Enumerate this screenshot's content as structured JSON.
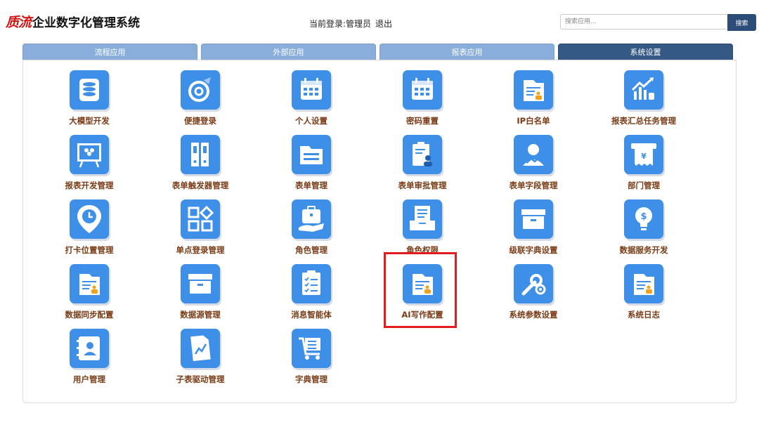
{
  "header": {
    "logo_mark": "质流",
    "title": "企业数字化管理系统",
    "login_label": "当前登录:管理员",
    "logout": "退出",
    "search_placeholder": "搜索应用...",
    "search_button": "搜索"
  },
  "tabs": [
    {
      "label": "流程应用",
      "active": false
    },
    {
      "label": "外部应用",
      "active": false
    },
    {
      "label": "报表应用",
      "active": false
    },
    {
      "label": "系统设置",
      "active": true
    }
  ],
  "apps": [
    {
      "label": "大模型开发",
      "icon": "database-icon"
    },
    {
      "label": "便捷登录",
      "icon": "quick-login-icon"
    },
    {
      "label": "个人设置",
      "icon": "calendar-icon"
    },
    {
      "label": "密码重置",
      "icon": "calendar-icon"
    },
    {
      "label": "IP白名单",
      "icon": "document-users-icon"
    },
    {
      "label": "报表汇总任务管理",
      "icon": "chart-growth-icon"
    },
    {
      "label": "报表开发管理",
      "icon": "presentation-board-icon"
    },
    {
      "label": "表单触发器管理",
      "icon": "binders-icon"
    },
    {
      "label": "表单管理",
      "icon": "folder-icon"
    },
    {
      "label": "表单审批管理",
      "icon": "clipboard-user-icon"
    },
    {
      "label": "表单字段管理",
      "icon": "user-chart-icon"
    },
    {
      "label": "部门管理",
      "icon": "receipt-icon"
    },
    {
      "label": "打卡位置管理",
      "icon": "location-clock-icon"
    },
    {
      "label": "单点登录管理",
      "icon": "grid-apps-icon"
    },
    {
      "label": "角色管理",
      "icon": "briefcase-hand-icon"
    },
    {
      "label": "角色权限",
      "icon": "document-tray-icon"
    },
    {
      "label": "级联字典设置",
      "icon": "archive-box-icon"
    },
    {
      "label": "数据服务开发",
      "icon": "lightbulb-dollar-icon"
    },
    {
      "label": "数据同步配置",
      "icon": "document-users-icon"
    },
    {
      "label": "数据源管理",
      "icon": "archive-box-icon"
    },
    {
      "label": "消息智能体",
      "icon": "checklist-icon"
    },
    {
      "label": "AI写作配置",
      "icon": "document-users-icon"
    },
    {
      "label": "系统参数设置",
      "icon": "wrench-gear-icon"
    },
    {
      "label": "系统日志",
      "icon": "document-users-icon"
    },
    {
      "label": "用户管理",
      "icon": "address-book-icon"
    },
    {
      "label": "子表驱动管理",
      "icon": "document-chart-icon"
    },
    {
      "label": "字典管理",
      "icon": "shopping-cart-icon"
    }
  ],
  "colors": {
    "icon_bg": "#3d8fe8",
    "label": "#7a3a14",
    "tab_active": "#335984",
    "tab_inactive": "#8aaedc",
    "highlight": "#e31d1d",
    "brand_red": "#d11616"
  }
}
